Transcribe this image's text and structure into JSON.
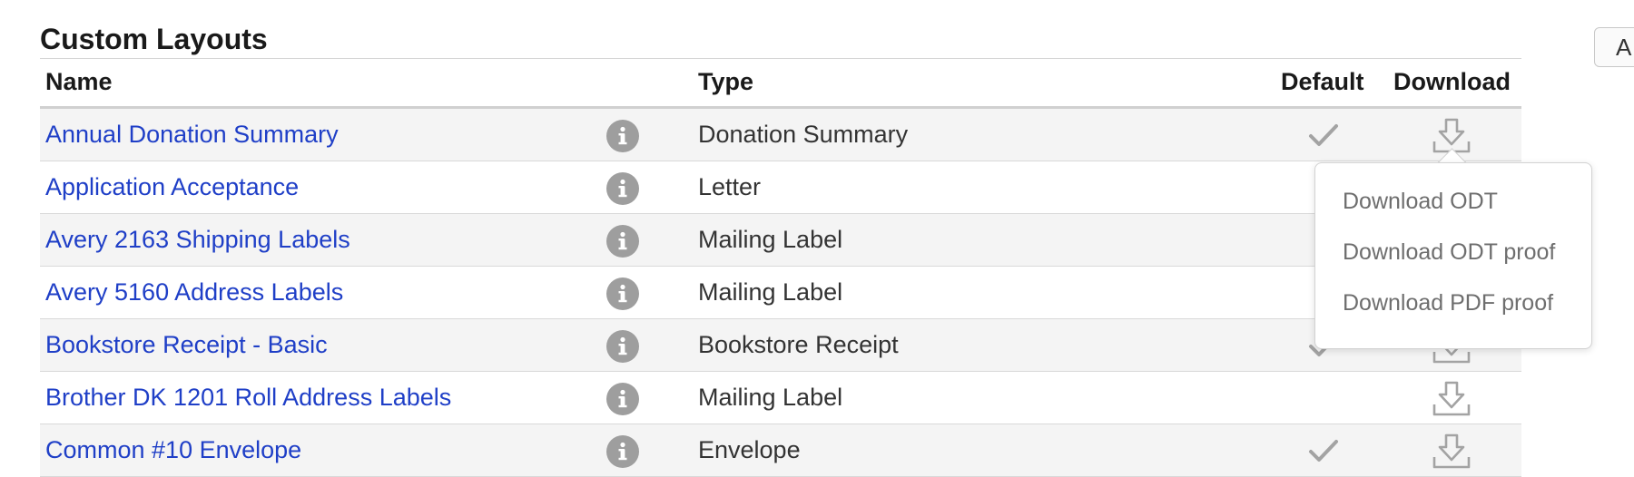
{
  "section": {
    "title": "Custom Layouts"
  },
  "side_button": {
    "label": "A"
  },
  "table": {
    "headers": {
      "name": "Name",
      "type": "Type",
      "default": "Default",
      "download": "Download"
    },
    "rows": [
      {
        "name": "Annual Donation Summary",
        "type": "Donation Summary",
        "is_default": true
      },
      {
        "name": "Application Acceptance",
        "type": "Letter",
        "is_default": false
      },
      {
        "name": "Avery 2163 Shipping Labels",
        "type": "Mailing Label",
        "is_default": false
      },
      {
        "name": "Avery 5160 Address Labels",
        "type": "Mailing Label",
        "is_default": false
      },
      {
        "name": "Bookstore Receipt - Basic",
        "type": "Bookstore Receipt",
        "is_default": true
      },
      {
        "name": "Brother DK 1201 Roll Address Labels",
        "type": "Mailing Label",
        "is_default": false
      },
      {
        "name": "Common #10 Envelope",
        "type": "Envelope",
        "is_default": true
      }
    ]
  },
  "download_menu": {
    "items": [
      "Download ODT",
      "Download ODT proof",
      "Download PDF proof"
    ]
  },
  "colors": {
    "link": "#1f3fc7",
    "icon_gray": "#9e9e9e",
    "row_stripe": "#f4f4f4"
  },
  "icons": {
    "info": "info-icon",
    "check": "checkmark-icon",
    "download": "download-icon"
  }
}
